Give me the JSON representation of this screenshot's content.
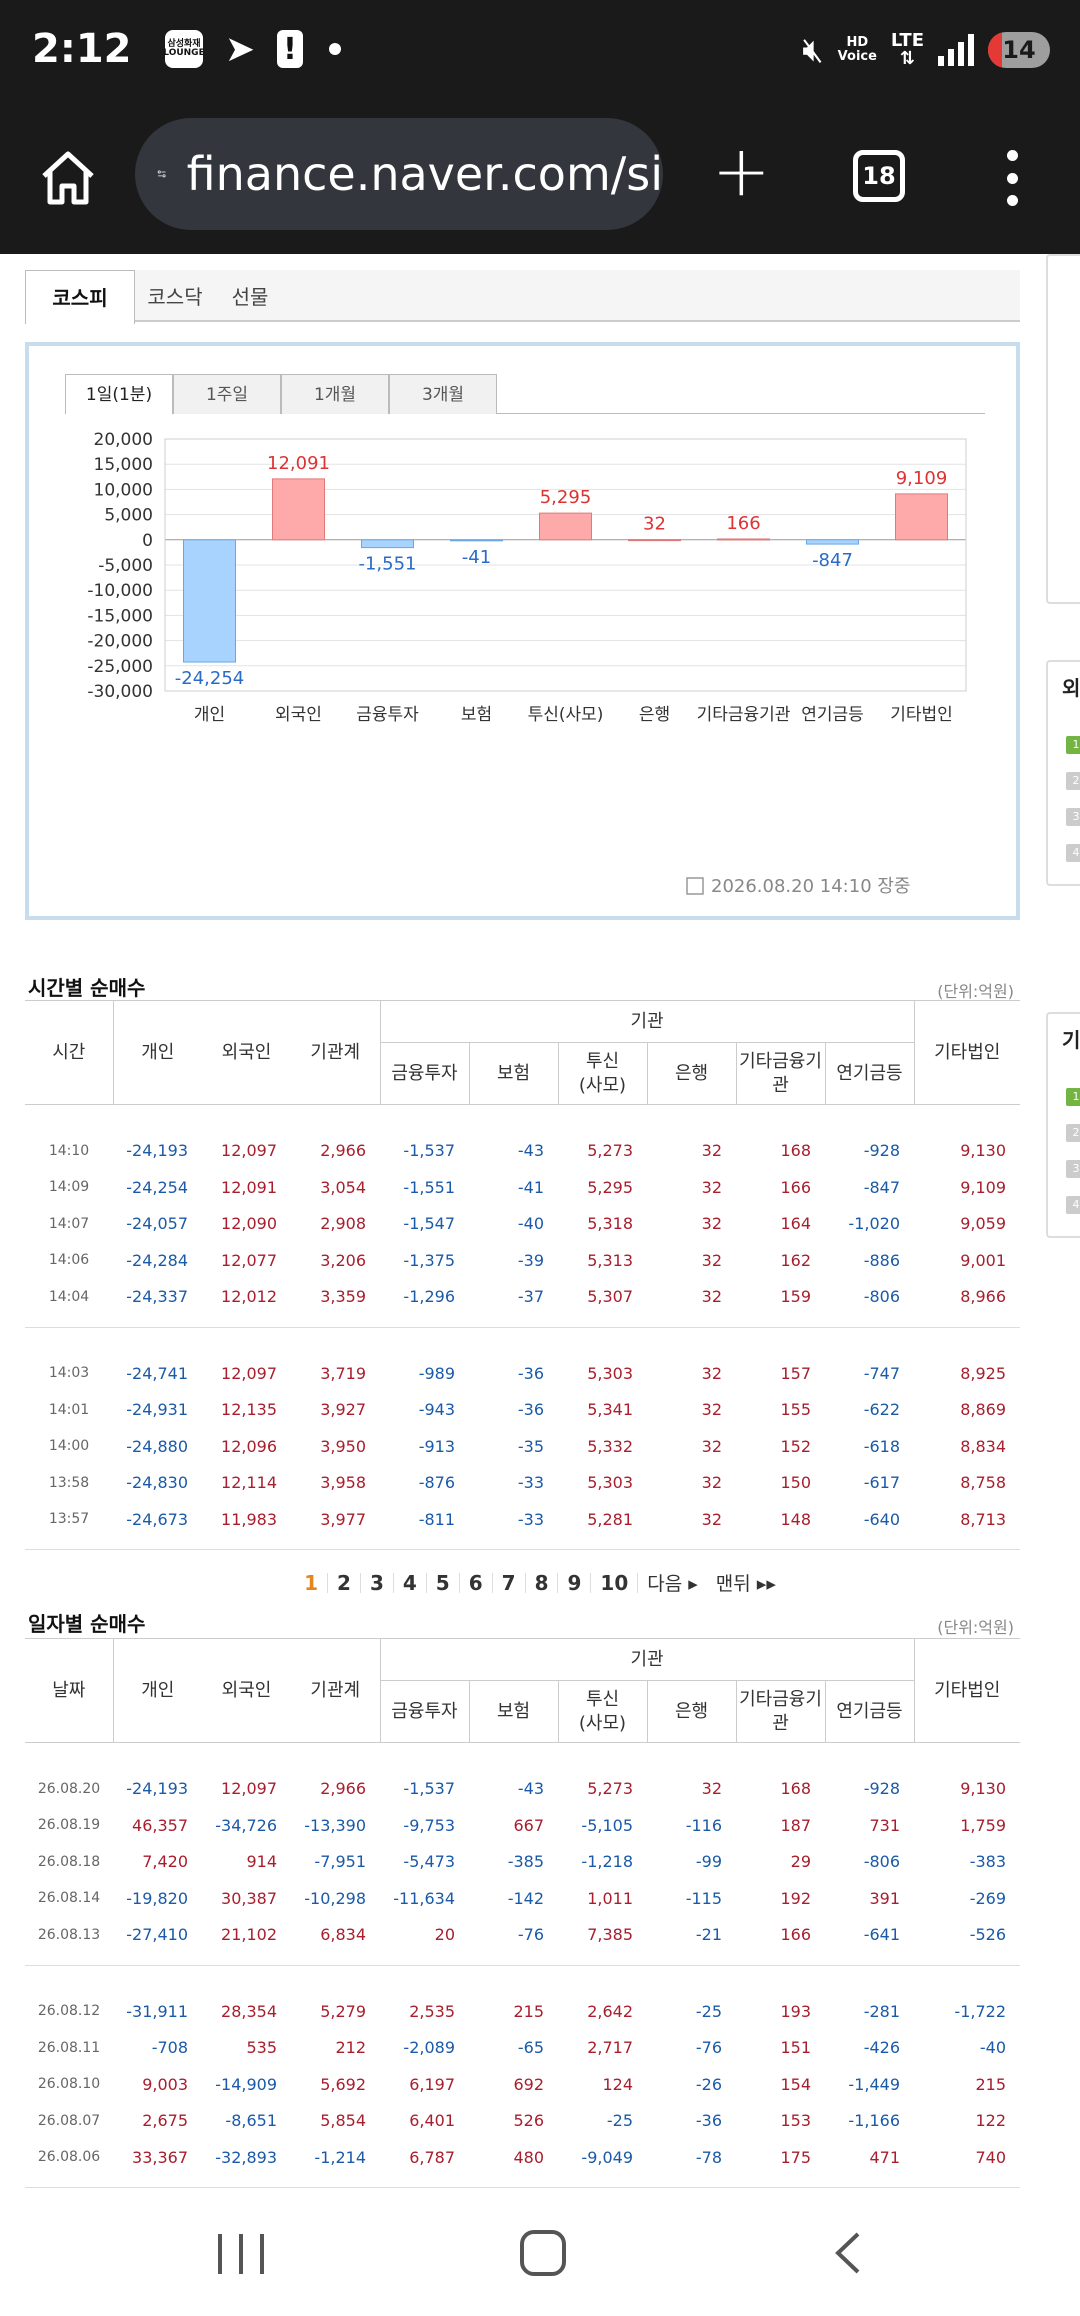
{
  "status": {
    "time": "2:12",
    "lounge": "삼성화재 LOUNGE",
    "battery": "14",
    "hd_top": "HD",
    "hd_bottom": "Voice",
    "lte": "LTE"
  },
  "browser": {
    "url": "finance.naver.com/si",
    "tabs_count": "18"
  },
  "market_tabs": [
    "코스피",
    "코스닥",
    "선물"
  ],
  "period_tabs": [
    "1일(1분)",
    "1주일",
    "1개월",
    "3개월"
  ],
  "chart_timestamp": "2026.08.20 14:10 장중",
  "chart_data": {
    "type": "bar",
    "categories": [
      "개인",
      "외국인",
      "금융투자",
      "보험",
      "투신(사모)",
      "은행",
      "기타금융기관",
      "연기금등",
      "기타법인"
    ],
    "values": [
      -24254,
      12091,
      -1551,
      -41,
      5295,
      32,
      166,
      -847,
      9109
    ],
    "value_labels": [
      "-24,254",
      "12,091",
      "-1,551",
      "-41",
      "5,295",
      "32",
      "166",
      "-847",
      "9,109"
    ],
    "ylim": [
      -30000,
      20000
    ],
    "yticks": [
      "20,000",
      "15,000",
      "10,000",
      "5,000",
      "0",
      "-5,000",
      "-10,000",
      "-15,000",
      "-20,000",
      "-25,000",
      "-30,000"
    ],
    "colors": {
      "positive_fill": "#ffaaaa",
      "positive_stroke": "#e07a7a",
      "negative_fill": "#a9d3ff",
      "negative_stroke": "#6aa7e0",
      "positive_text": "#d33",
      "negative_text": "#2a6ac8"
    },
    "grid": true
  },
  "time_table": {
    "title": "시간별 순매수",
    "unit": "(단위:억원)",
    "headers": {
      "time": "시간",
      "individual": "개인",
      "foreign": "외국인",
      "inst_total": "기관계",
      "inst": "기관",
      "fin": "금융투자",
      "ins": "보험",
      "trust_a": "투신",
      "trust_b": "(사모)",
      "bank": "은행",
      "other_fin_a": "기타금융기",
      "other_fin_b": "관",
      "pension": "연기금등",
      "corp": "기타법인"
    },
    "rows": [
      [
        "14:10",
        "-24,193",
        "12,097",
        "2,966",
        "-1,537",
        "-43",
        "5,273",
        "32",
        "168",
        "-928",
        "9,130"
      ],
      [
        "14:09",
        "-24,254",
        "12,091",
        "3,054",
        "-1,551",
        "-41",
        "5,295",
        "32",
        "166",
        "-847",
        "9,109"
      ],
      [
        "14:07",
        "-24,057",
        "12,090",
        "2,908",
        "-1,547",
        "-40",
        "5,318",
        "32",
        "164",
        "-1,020",
        "9,059"
      ],
      [
        "14:06",
        "-24,284",
        "12,077",
        "3,206",
        "-1,375",
        "-39",
        "5,313",
        "32",
        "162",
        "-886",
        "9,001"
      ],
      [
        "14:04",
        "-24,337",
        "12,012",
        "3,359",
        "-1,296",
        "-37",
        "5,307",
        "32",
        "159",
        "-806",
        "8,966"
      ],
      [
        "14:03",
        "-24,741",
        "12,097",
        "3,719",
        "-989",
        "-36",
        "5,303",
        "32",
        "157",
        "-747",
        "8,925"
      ],
      [
        "14:01",
        "-24,931",
        "12,135",
        "3,927",
        "-943",
        "-36",
        "5,341",
        "32",
        "155",
        "-622",
        "8,869"
      ],
      [
        "14:00",
        "-24,880",
        "12,096",
        "3,950",
        "-913",
        "-35",
        "5,332",
        "32",
        "152",
        "-618",
        "8,834"
      ],
      [
        "13:58",
        "-24,830",
        "12,114",
        "3,958",
        "-876",
        "-33",
        "5,303",
        "32",
        "150",
        "-617",
        "8,758"
      ],
      [
        "13:57",
        "-24,673",
        "11,983",
        "3,977",
        "-811",
        "-33",
        "5,281",
        "32",
        "148",
        "-640",
        "8,713"
      ]
    ]
  },
  "pager": {
    "pages": [
      "1",
      "2",
      "3",
      "4",
      "5",
      "6",
      "7",
      "8",
      "9",
      "10"
    ],
    "next": "다음",
    "last": "맨뒤"
  },
  "date_table": {
    "title": "일자별 순매수",
    "unit": "(단위:억원)",
    "headers": {
      "date": "날짜",
      "individual": "개인",
      "foreign": "외국인",
      "inst_total": "기관계",
      "inst": "기관",
      "fin": "금융투자",
      "ins": "보험",
      "trust_a": "투신",
      "trust_b": "(사모)",
      "bank": "은행",
      "other_fin_a": "기타금융기",
      "other_fin_b": "관",
      "pension": "연기금등",
      "corp": "기타법인"
    },
    "rows": [
      [
        "26.08.20",
        "-24,193",
        "12,097",
        "2,966",
        "-1,537",
        "-43",
        "5,273",
        "32",
        "168",
        "-928",
        "9,130"
      ],
      [
        "26.08.19",
        "46,357",
        "-34,726",
        "-13,390",
        "-9,753",
        "667",
        "-5,105",
        "-116",
        "187",
        "731",
        "1,759"
      ],
      [
        "26.08.18",
        "7,420",
        "914",
        "-7,951",
        "-5,473",
        "-385",
        "-1,218",
        "-99",
        "29",
        "-806",
        "-383"
      ],
      [
        "26.08.14",
        "-19,820",
        "30,387",
        "-10,298",
        "-11,634",
        "-142",
        "1,011",
        "-115",
        "192",
        "391",
        "-269"
      ],
      [
        "26.08.13",
        "-27,410",
        "21,102",
        "6,834",
        "20",
        "-76",
        "7,385",
        "-21",
        "166",
        "-641",
        "-526"
      ],
      [
        "26.08.12",
        "-31,911",
        "28,354",
        "5,279",
        "2,535",
        "215",
        "2,642",
        "-25",
        "193",
        "-281",
        "-1,722"
      ],
      [
        "26.08.11",
        "-708",
        "535",
        "212",
        "-2,089",
        "-65",
        "2,717",
        "-76",
        "151",
        "-426",
        "-40"
      ],
      [
        "26.08.10",
        "9,003",
        "-14,909",
        "5,692",
        "6,197",
        "692",
        "124",
        "-26",
        "154",
        "-1,449",
        "215"
      ],
      [
        "26.08.07",
        "2,675",
        "-8,651",
        "5,854",
        "6,401",
        "526",
        "-25",
        "-36",
        "153",
        "-1,166",
        "122"
      ],
      [
        "26.08.06",
        "33,367",
        "-32,893",
        "-1,214",
        "6,787",
        "480",
        "-9,049",
        "-78",
        "175",
        "471",
        "740"
      ]
    ]
  }
}
